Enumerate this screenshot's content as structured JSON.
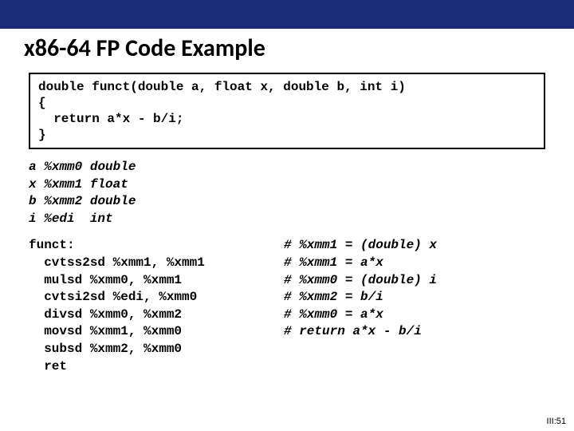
{
  "title": "x86-64 FP Code Example",
  "code": {
    "l1": "double funct(double a, float x, double b, int i)",
    "l2": "{",
    "l3": "  return a*x - b/i;",
    "l4": "}"
  },
  "regmap": [
    {
      "var": "a",
      "reg": "%xmm0",
      "type": "double"
    },
    {
      "var": "x",
      "reg": "%xmm1",
      "type": "float"
    },
    {
      "var": "b",
      "reg": "%xmm2",
      "type": "double"
    },
    {
      "var": "i",
      "reg": "%edi",
      "type": "int"
    }
  ],
  "asm": {
    "left": [
      "funct:",
      "  cvtss2sd %xmm1, %xmm1",
      "  mulsd %xmm0, %xmm1",
      "  cvtsi2sd %edi, %xmm0",
      "  divsd %xmm0, %xmm2",
      "  movsd %xmm1, %xmm0",
      "  subsd %xmm2, %xmm0",
      "  ret"
    ],
    "right": [
      "",
      "# %xmm1 = (double) x",
      "# %xmm1 = a*x",
      "# %xmm0 = (double) i",
      "# %xmm2 = b/i",
      "# %xmm0 = a*x",
      "# return a*x - b/i",
      ""
    ]
  },
  "pagenum": "III:51"
}
